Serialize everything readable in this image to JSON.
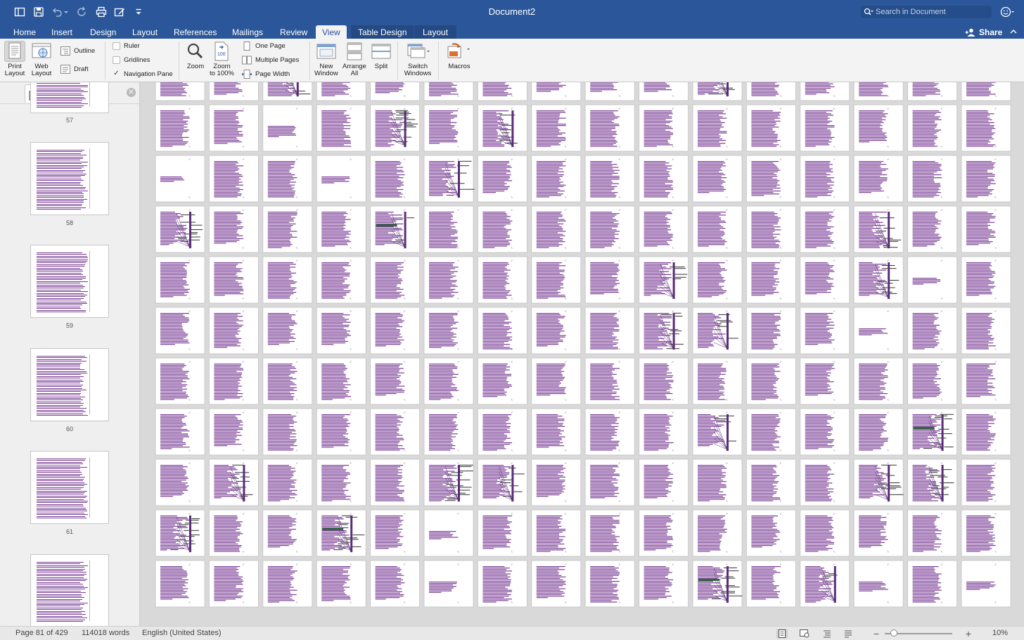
{
  "window": {
    "title": "Document2"
  },
  "search": {
    "placeholder": "Search in Document"
  },
  "tabs": [
    {
      "label": "Home"
    },
    {
      "label": "Insert"
    },
    {
      "label": "Design"
    },
    {
      "label": "Layout"
    },
    {
      "label": "References"
    },
    {
      "label": "Mailings"
    },
    {
      "label": "Review"
    },
    {
      "label": "View"
    },
    {
      "label": "Table Design"
    },
    {
      "label": "Layout"
    }
  ],
  "active_tab": "View",
  "share_label": "Share",
  "ribbon": {
    "print_layout": [
      "Print",
      "Layout"
    ],
    "web_layout": [
      "Web",
      "Layout"
    ],
    "outline": "Outline",
    "draft": "Draft",
    "ruler": "Ruler",
    "gridlines": "Gridlines",
    "navigation_pane": "Navigation Pane",
    "zoom": "Zoom",
    "zoom_100": [
      "Zoom",
      "to 100%"
    ],
    "one_page": "One Page",
    "multiple_pages": "Multiple Pages",
    "page_width": "Page Width",
    "new_window": [
      "New",
      "Window"
    ],
    "arrange_all": [
      "Arrange",
      "All"
    ],
    "split": "Split",
    "switch_windows": [
      "Switch",
      "Windows"
    ],
    "macros": "Macros"
  },
  "nav": {
    "page_numbers": [
      "57",
      "58",
      "59",
      "60",
      "61"
    ]
  },
  "status": {
    "page": "Page 81 of 429",
    "words": "114018 words",
    "language": "English (United States)",
    "zoom_level": "10%"
  },
  "colors": {
    "brand": "#2b579a",
    "text_line": "#7a3d96",
    "figure_dark": "#5a2d78",
    "figure_green": "#2d6a3a"
  }
}
